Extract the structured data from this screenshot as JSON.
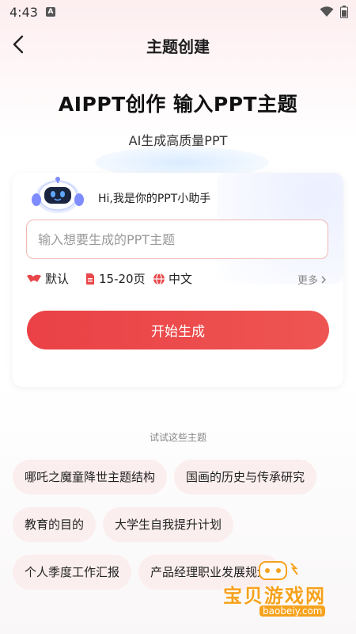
{
  "status_bar": {
    "time": "4:43",
    "notification_badge": "A"
  },
  "header": {
    "title": "主题创建"
  },
  "hero": {
    "title": "AIPPT创作  输入PPT主题",
    "subtitle": "AI生成高质量PPT"
  },
  "assistant": {
    "greeting": "Hi,我是你的PPT小助手"
  },
  "topic_input": {
    "placeholder": "输入想要生成的PPT主题",
    "value": ""
  },
  "options": {
    "style": {
      "label": "默认",
      "icon": "style-icon"
    },
    "pages": {
      "label": "15-20页",
      "icon": "document-icon"
    },
    "language": {
      "label": "中文",
      "icon": "globe-icon"
    },
    "more_label": "更多"
  },
  "start_button": {
    "label": "开始生成"
  },
  "suggestions": {
    "label": "试试这些主题",
    "items": [
      "哪吒之魔童降世主题结构",
      "国画的历史与传承研究",
      "教育的目的",
      "大学生自我提升计划",
      "个人季度工作汇报",
      "产品经理职业发展规划"
    ]
  },
  "watermark": {
    "text": "宝贝游戏网",
    "url": "baobeiy.com"
  },
  "colors": {
    "accent": "#e9474a",
    "chip_bg": "#fbeeee",
    "input_border": "#f0b7b5"
  }
}
